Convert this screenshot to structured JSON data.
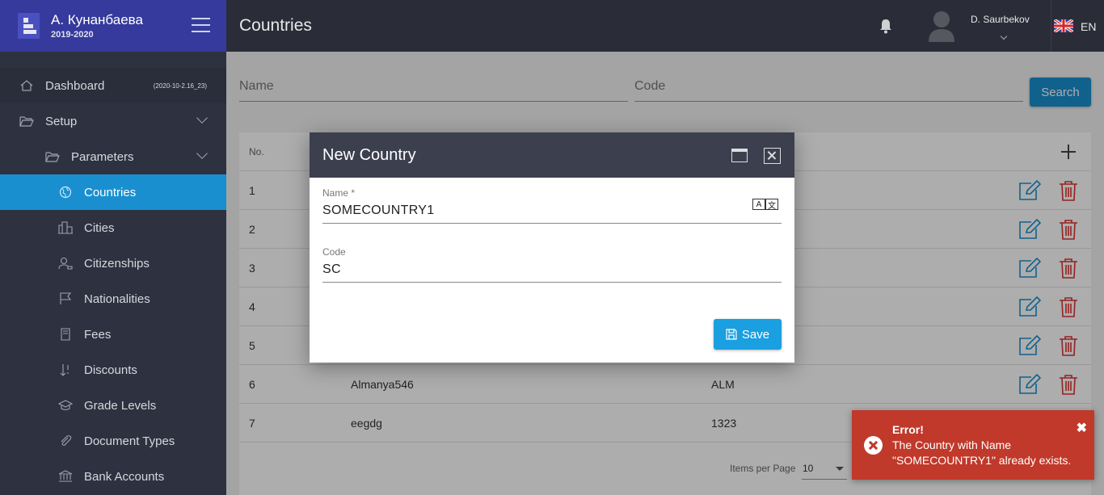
{
  "brand": {
    "name": "А. Кунанбаева",
    "year": "2019-2020"
  },
  "sidebar": {
    "items": [
      {
        "label": "Dashboard",
        "icon": "home-icon",
        "badge": "(2020-10-2.16_23)"
      },
      {
        "label": "Setup",
        "icon": "folder-open-icon"
      },
      {
        "label": "Parameters",
        "icon": "folder-open-icon"
      },
      {
        "label": "Countries",
        "icon": "globe-icon"
      },
      {
        "label": "Cities",
        "icon": "city-icon"
      },
      {
        "label": "Citizenships",
        "icon": "user-badge-icon"
      },
      {
        "label": "Nationalities",
        "icon": "flag-icon"
      },
      {
        "label": "Fees",
        "icon": "receipt-icon"
      },
      {
        "label": "Discounts",
        "icon": "sort-icon"
      },
      {
        "label": "Grade Levels",
        "icon": "graduation-cap-icon"
      },
      {
        "label": "Document Types",
        "icon": "paperclip-icon"
      },
      {
        "label": "Bank Accounts",
        "icon": "bank-icon"
      }
    ]
  },
  "header": {
    "title": "Countries",
    "username": "D. Saurbekov",
    "language": "EN"
  },
  "filters": {
    "name_placeholder": "Name",
    "code_placeholder": "Code",
    "search_label": "Search"
  },
  "table": {
    "no_header": "No.",
    "rows": [
      {
        "no": "1",
        "name": "",
        "code": ""
      },
      {
        "no": "2",
        "name": "",
        "code": ""
      },
      {
        "no": "3",
        "name": "",
        "code": ""
      },
      {
        "no": "4",
        "name": "",
        "code": ""
      },
      {
        "no": "5",
        "name": "",
        "code": ""
      },
      {
        "no": "6",
        "name": "Almanya546",
        "code": "ALM"
      },
      {
        "no": "7",
        "name": "eegdg",
        "code": "1323"
      }
    ],
    "items_per_page_label": "Items per Page",
    "items_per_page_value": "10"
  },
  "dialog": {
    "title": "New Country",
    "name_label": "Name *",
    "name_value": "SOMECOUNTRY1",
    "code_label": "Code",
    "code_value": "SC",
    "save_label": "Save",
    "translate_a": "A",
    "translate_b": "文"
  },
  "toast": {
    "title": "Error!",
    "message": "The Country with Name \"SOMECOUNTRY1\" already exists.",
    "close": "✖"
  },
  "colors": {
    "accent": "#1a8fd0",
    "brand": "#353a9c",
    "error": "#c0392b",
    "sidebar": "#2e3240"
  }
}
